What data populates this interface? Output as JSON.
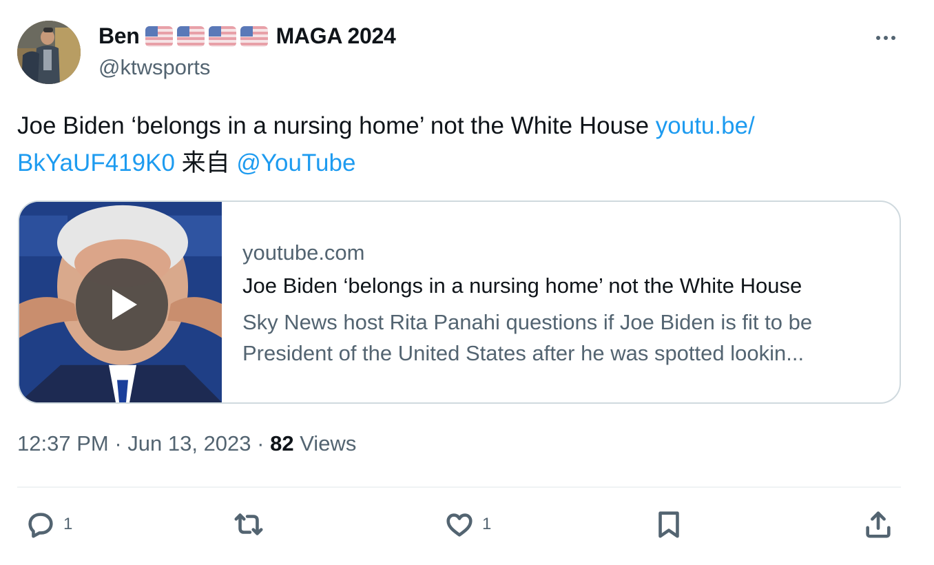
{
  "author": {
    "display_name": "Ben",
    "display_suffix": "MAGA 2024",
    "flag_emojis": [
      "flag-us",
      "flag-us",
      "flag-us",
      "flag-us"
    ],
    "handle": "@ktwsports"
  },
  "tweet": {
    "text": "Joe Biden ‘belongs in a nursing home’ not the White House ",
    "link_part1": "youtu.be/",
    "link_part2": "BkYaUF419K0",
    "via_text": " 来自 ",
    "mention": "@YouTube"
  },
  "card": {
    "domain": "youtube.com",
    "title": "Joe Biden ‘belongs in a nursing home’ not the White House",
    "description": "Sky News host Rita Panahi questions if Joe Biden is fit to be President of the United States after he was spotted lookin...",
    "thumbnail_icon": "play-icon"
  },
  "meta": {
    "time": "12:37 PM",
    "separator": " · ",
    "date": "Jun 13, 2023",
    "views_count": "82",
    "views_label": " Views"
  },
  "actions": {
    "reply_count": "1",
    "retweet_count": "",
    "like_count": "1"
  },
  "colors": {
    "link": "#1d9bf0",
    "secondary_text": "#536471",
    "primary_text": "#0f1419",
    "border": "#cfd9de"
  }
}
